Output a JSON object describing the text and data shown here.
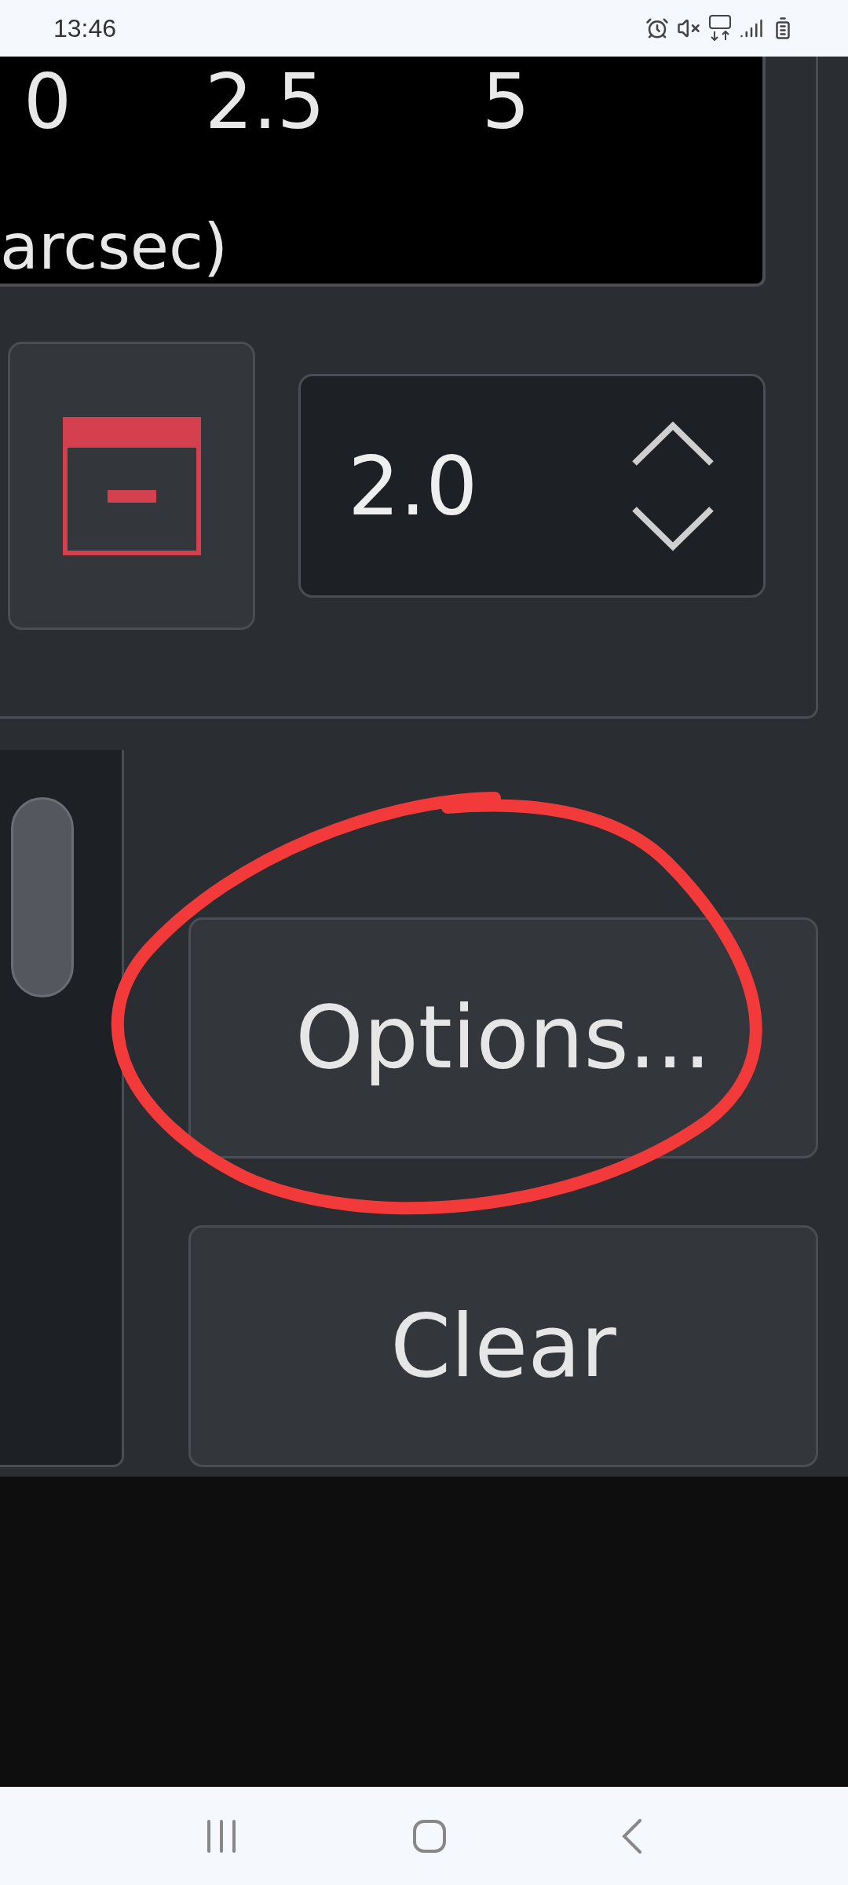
{
  "status_bar": {
    "time": "13:46"
  },
  "plot": {
    "tick_labels": [
      "0",
      "2.5",
      "5"
    ],
    "axis_label": "arcsec)"
  },
  "spin_box": {
    "value": "2.0"
  },
  "buttons": [
    {
      "label": "Options..."
    },
    {
      "label": "Clear"
    }
  ]
}
